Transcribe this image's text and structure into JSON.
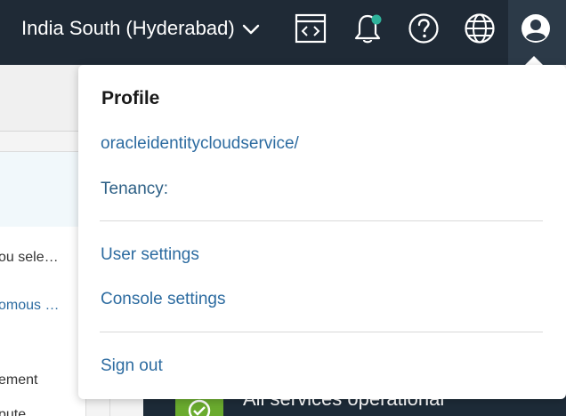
{
  "header": {
    "region_label": "India South (Hyderabad)",
    "icons": [
      "code-editor-icon",
      "notification-bell-icon",
      "help-icon",
      "language-globe-icon",
      "user-profile-icon"
    ],
    "notification_dot_color": "#2fb39b",
    "background_color": "#1f2a36"
  },
  "profile_menu": {
    "title": "Profile",
    "identity_link": "oracleidentitycloudservice/",
    "tenancy_label": "Tenancy:",
    "user_settings": "User settings",
    "console_settings": "Console settings",
    "sign_out": "Sign out",
    "link_color": "#2c6ba0"
  },
  "background_page": {
    "items": [
      "ou sele…",
      "omous …",
      "ement",
      "pute"
    ],
    "status_banner": "All services operational",
    "status_color": "#6aab2e"
  }
}
